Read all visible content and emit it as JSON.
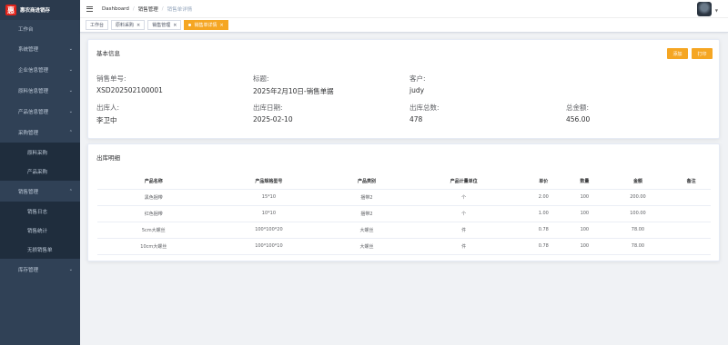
{
  "brand": {
    "logo_char": "惠",
    "name": "惠农商进销存"
  },
  "sidebar": {
    "items": [
      {
        "label": "工作台"
      },
      {
        "label": "系统管理"
      },
      {
        "label": "企业信息管理"
      },
      {
        "label": "原料信息管理"
      },
      {
        "label": "产品信息管理"
      },
      {
        "label": "采购管理"
      },
      {
        "label": "原料采购"
      },
      {
        "label": "产品采购"
      },
      {
        "label": "销售管理"
      },
      {
        "label": "销售日志"
      },
      {
        "label": "销售统计"
      },
      {
        "label": "无损销售单"
      },
      {
        "label": "库存管理"
      }
    ]
  },
  "header": {
    "breadcrumb": [
      "Dashboard",
      "销售管理",
      "销售单详情"
    ]
  },
  "tags": [
    {
      "label": "工作台"
    },
    {
      "label": "原料采购",
      "close": "×"
    },
    {
      "label": "销售管理",
      "close": "×"
    },
    {
      "label": "销售单详情",
      "close": "×"
    }
  ],
  "basic_info": {
    "title": "基本信息",
    "add_label": "添加",
    "print_label": "打印",
    "fields": [
      {
        "label": "销售单号:",
        "value": "XSD202502100001"
      },
      {
        "label": "标题:",
        "value": "2025年2月10日-销售单据"
      },
      {
        "label": "客户:",
        "value": "judy"
      },
      {
        "label": "",
        "value": ""
      },
      {
        "label": "出库人:",
        "value": "李卫中"
      },
      {
        "label": "出库日期:",
        "value": "2025-02-10"
      },
      {
        "label": "出库总数:",
        "value": "478"
      },
      {
        "label": "总金额:",
        "value": "456.00"
      }
    ]
  },
  "detail": {
    "title": "出库明细",
    "columns": [
      "产品名称",
      "产品规格型号",
      "产品类别",
      "产品计量单位",
      "单价",
      "数量",
      "金额",
      "备注"
    ],
    "rows": [
      [
        "黑色捆带",
        "15*10",
        "捆带2",
        "个",
        "2.00",
        "100",
        "200.00",
        ""
      ],
      [
        "红色捆带",
        "10*10",
        "捆带2",
        "个",
        "1.00",
        "100",
        "100.00",
        ""
      ],
      [
        "5cm大螺丝",
        "100*100*20",
        "大螺丝",
        "件",
        "0.78",
        "100",
        "78.00",
        ""
      ],
      [
        "10cm大螺丝",
        "100*100*10",
        "大螺丝",
        "件",
        "0.78",
        "100",
        "78.00",
        ""
      ]
    ]
  },
  "colors": {
    "accent": "#f5a623",
    "sidebar_bg": "#304156",
    "sidebar_sub_bg": "#1f2d3d"
  }
}
